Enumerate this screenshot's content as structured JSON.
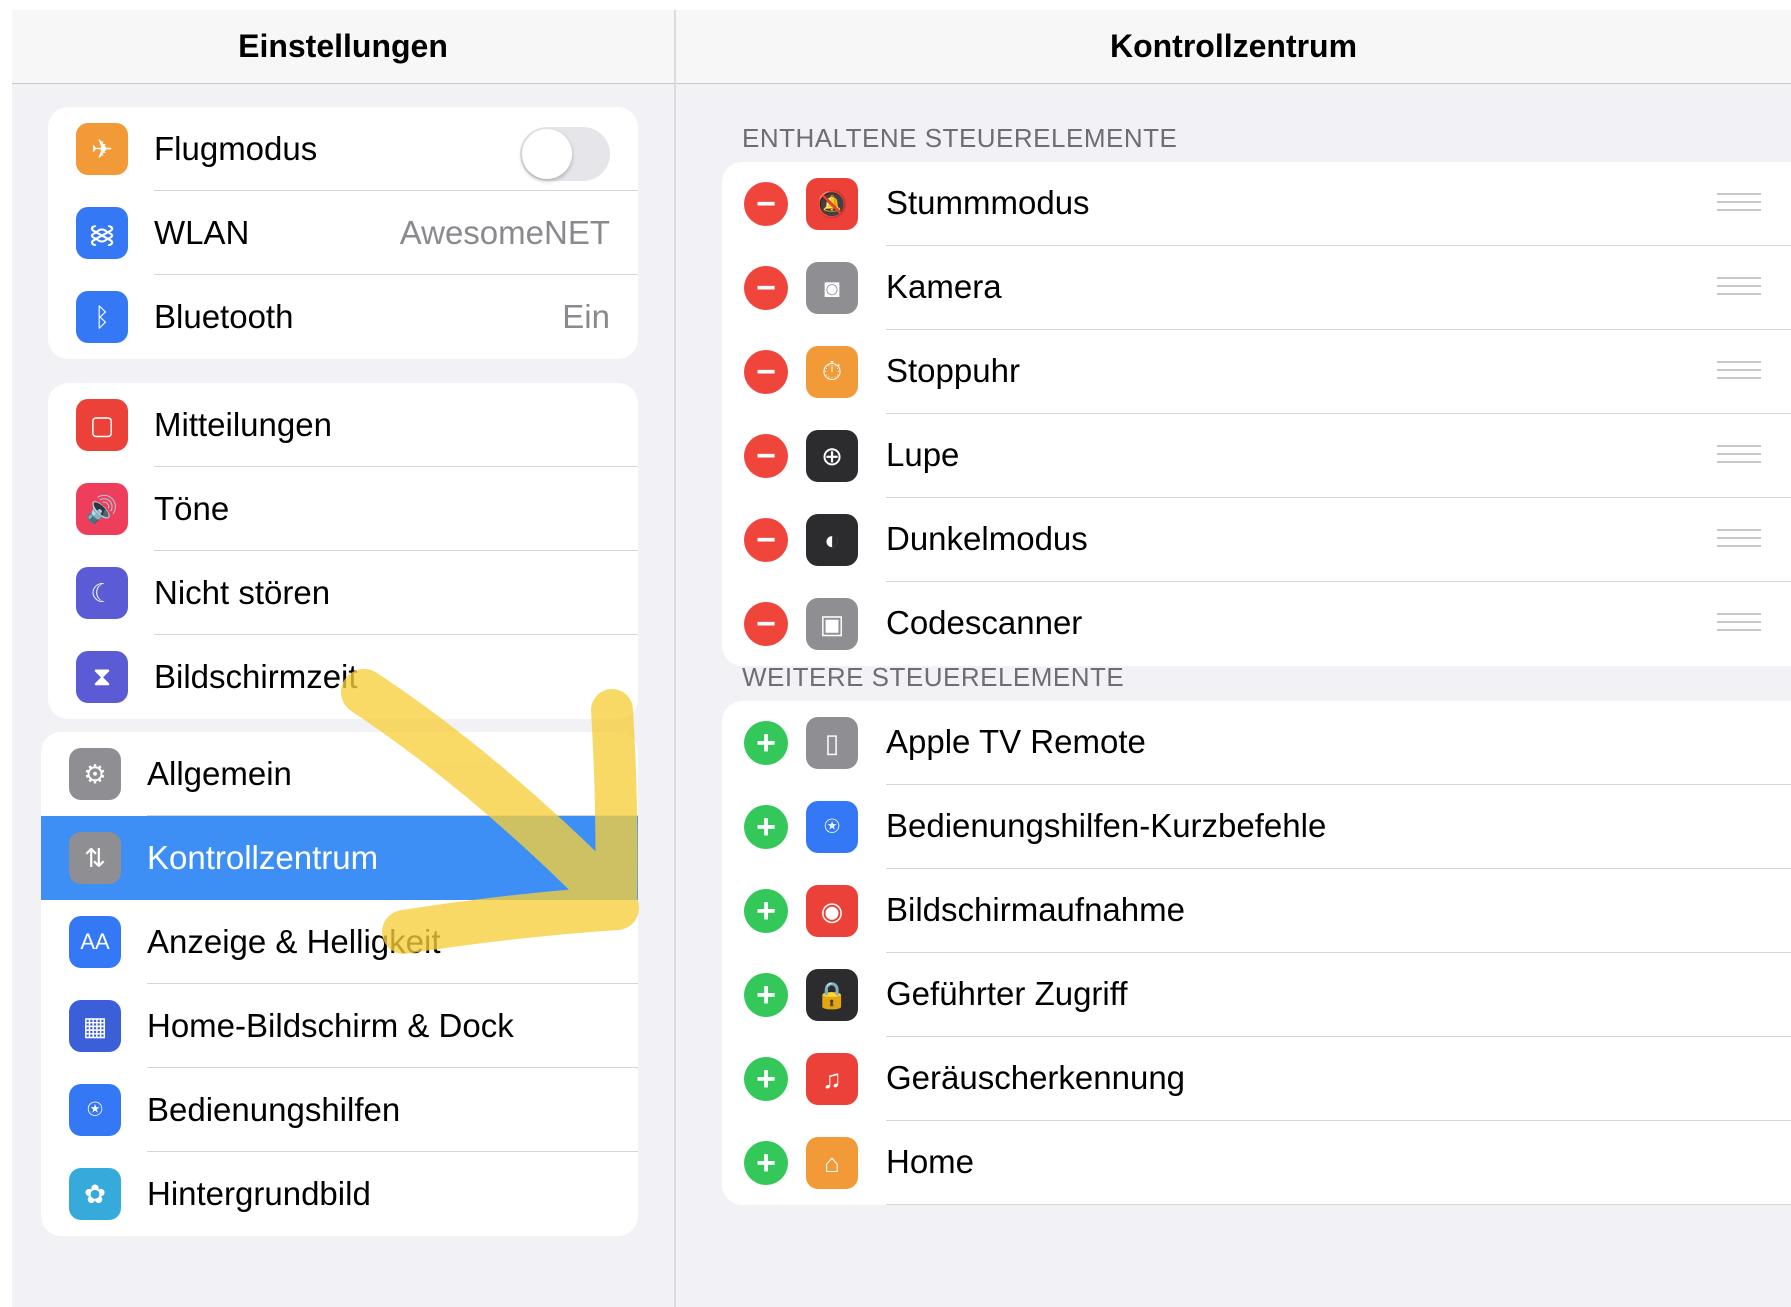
{
  "left": {
    "title": "Einstellungen",
    "group1": [
      {
        "label": "Flugmodus",
        "icon": "airplane-icon",
        "color": "#f19a37",
        "toggle": false
      },
      {
        "label": "WLAN",
        "icon": "wifi-icon",
        "color": "#3478f6",
        "value": "AwesomeNET"
      },
      {
        "label": "Bluetooth",
        "icon": "bluetooth-icon",
        "color": "#3478f6",
        "value": "Ein"
      }
    ],
    "group2": [
      {
        "label": "Mitteilungen",
        "icon": "notifications-icon",
        "color": "#ec4138"
      },
      {
        "label": "Töne",
        "icon": "speaker-icon",
        "color": "#ef3e5b"
      },
      {
        "label": "Nicht stören",
        "icon": "moon-icon",
        "color": "#5b5bd6"
      },
      {
        "label": "Bildschirmzeit",
        "icon": "hourglass-icon",
        "color": "#5b5bd6"
      }
    ],
    "group3": [
      {
        "label": "Allgemein",
        "icon": "gear-icon",
        "color": "#8e8e93"
      },
      {
        "label": "Kontrollzentrum",
        "icon": "switches-icon",
        "color": "#8e8e93",
        "selected": true
      },
      {
        "label": "Anzeige & Helligkeit",
        "icon": "aa-icon",
        "color": "#3478f6",
        "glyph": "AA"
      },
      {
        "label": "Home-Bildschirm & Dock",
        "icon": "app-grid-icon",
        "color": "#3a5fd9"
      },
      {
        "label": "Bedienungshilfen",
        "icon": "accessibility-icon",
        "color": "#3478f6"
      },
      {
        "label": "Hintergrundbild",
        "icon": "flower-icon",
        "color": "#37aadc"
      }
    ]
  },
  "right": {
    "title": "Kontrollzentrum",
    "included_header": "ENTHALTENE STEUERELEMENTE",
    "included": [
      {
        "label": "Stummmodus",
        "icon": "bell-slash-icon",
        "color": "#ec4138"
      },
      {
        "label": "Kamera",
        "icon": "camera-icon",
        "color": "#8e8e93"
      },
      {
        "label": "Stoppuhr",
        "icon": "stopwatch-icon",
        "color": "#f19a37"
      },
      {
        "label": "Lupe",
        "icon": "magnifier-icon",
        "color": "#2c2c2e"
      },
      {
        "label": "Dunkelmodus",
        "icon": "dark-mode-icon",
        "color": "#2c2c2e"
      },
      {
        "label": "Codescanner",
        "icon": "qr-code-icon",
        "color": "#8e8e93"
      }
    ],
    "more_header": "WEITERE STEUERELEMENTE",
    "more": [
      {
        "label": "Apple TV Remote",
        "icon": "remote-icon",
        "color": "#8e8e93"
      },
      {
        "label": "Bedienungshilfen-Kurzbefehle",
        "icon": "accessibility-icon",
        "color": "#3478f6"
      },
      {
        "label": "Bildschirmaufnahme",
        "icon": "record-icon",
        "color": "#ec4138"
      },
      {
        "label": "Geführter Zugriff",
        "icon": "lock-icon",
        "color": "#2c2c2e"
      },
      {
        "label": "Geräuscherkennung",
        "icon": "sound-recognition-icon",
        "color": "#ec4138"
      },
      {
        "label": "Home",
        "icon": "home-icon",
        "color": "#f19a37"
      }
    ]
  },
  "annotation": {
    "color": "#f7cf3c"
  }
}
